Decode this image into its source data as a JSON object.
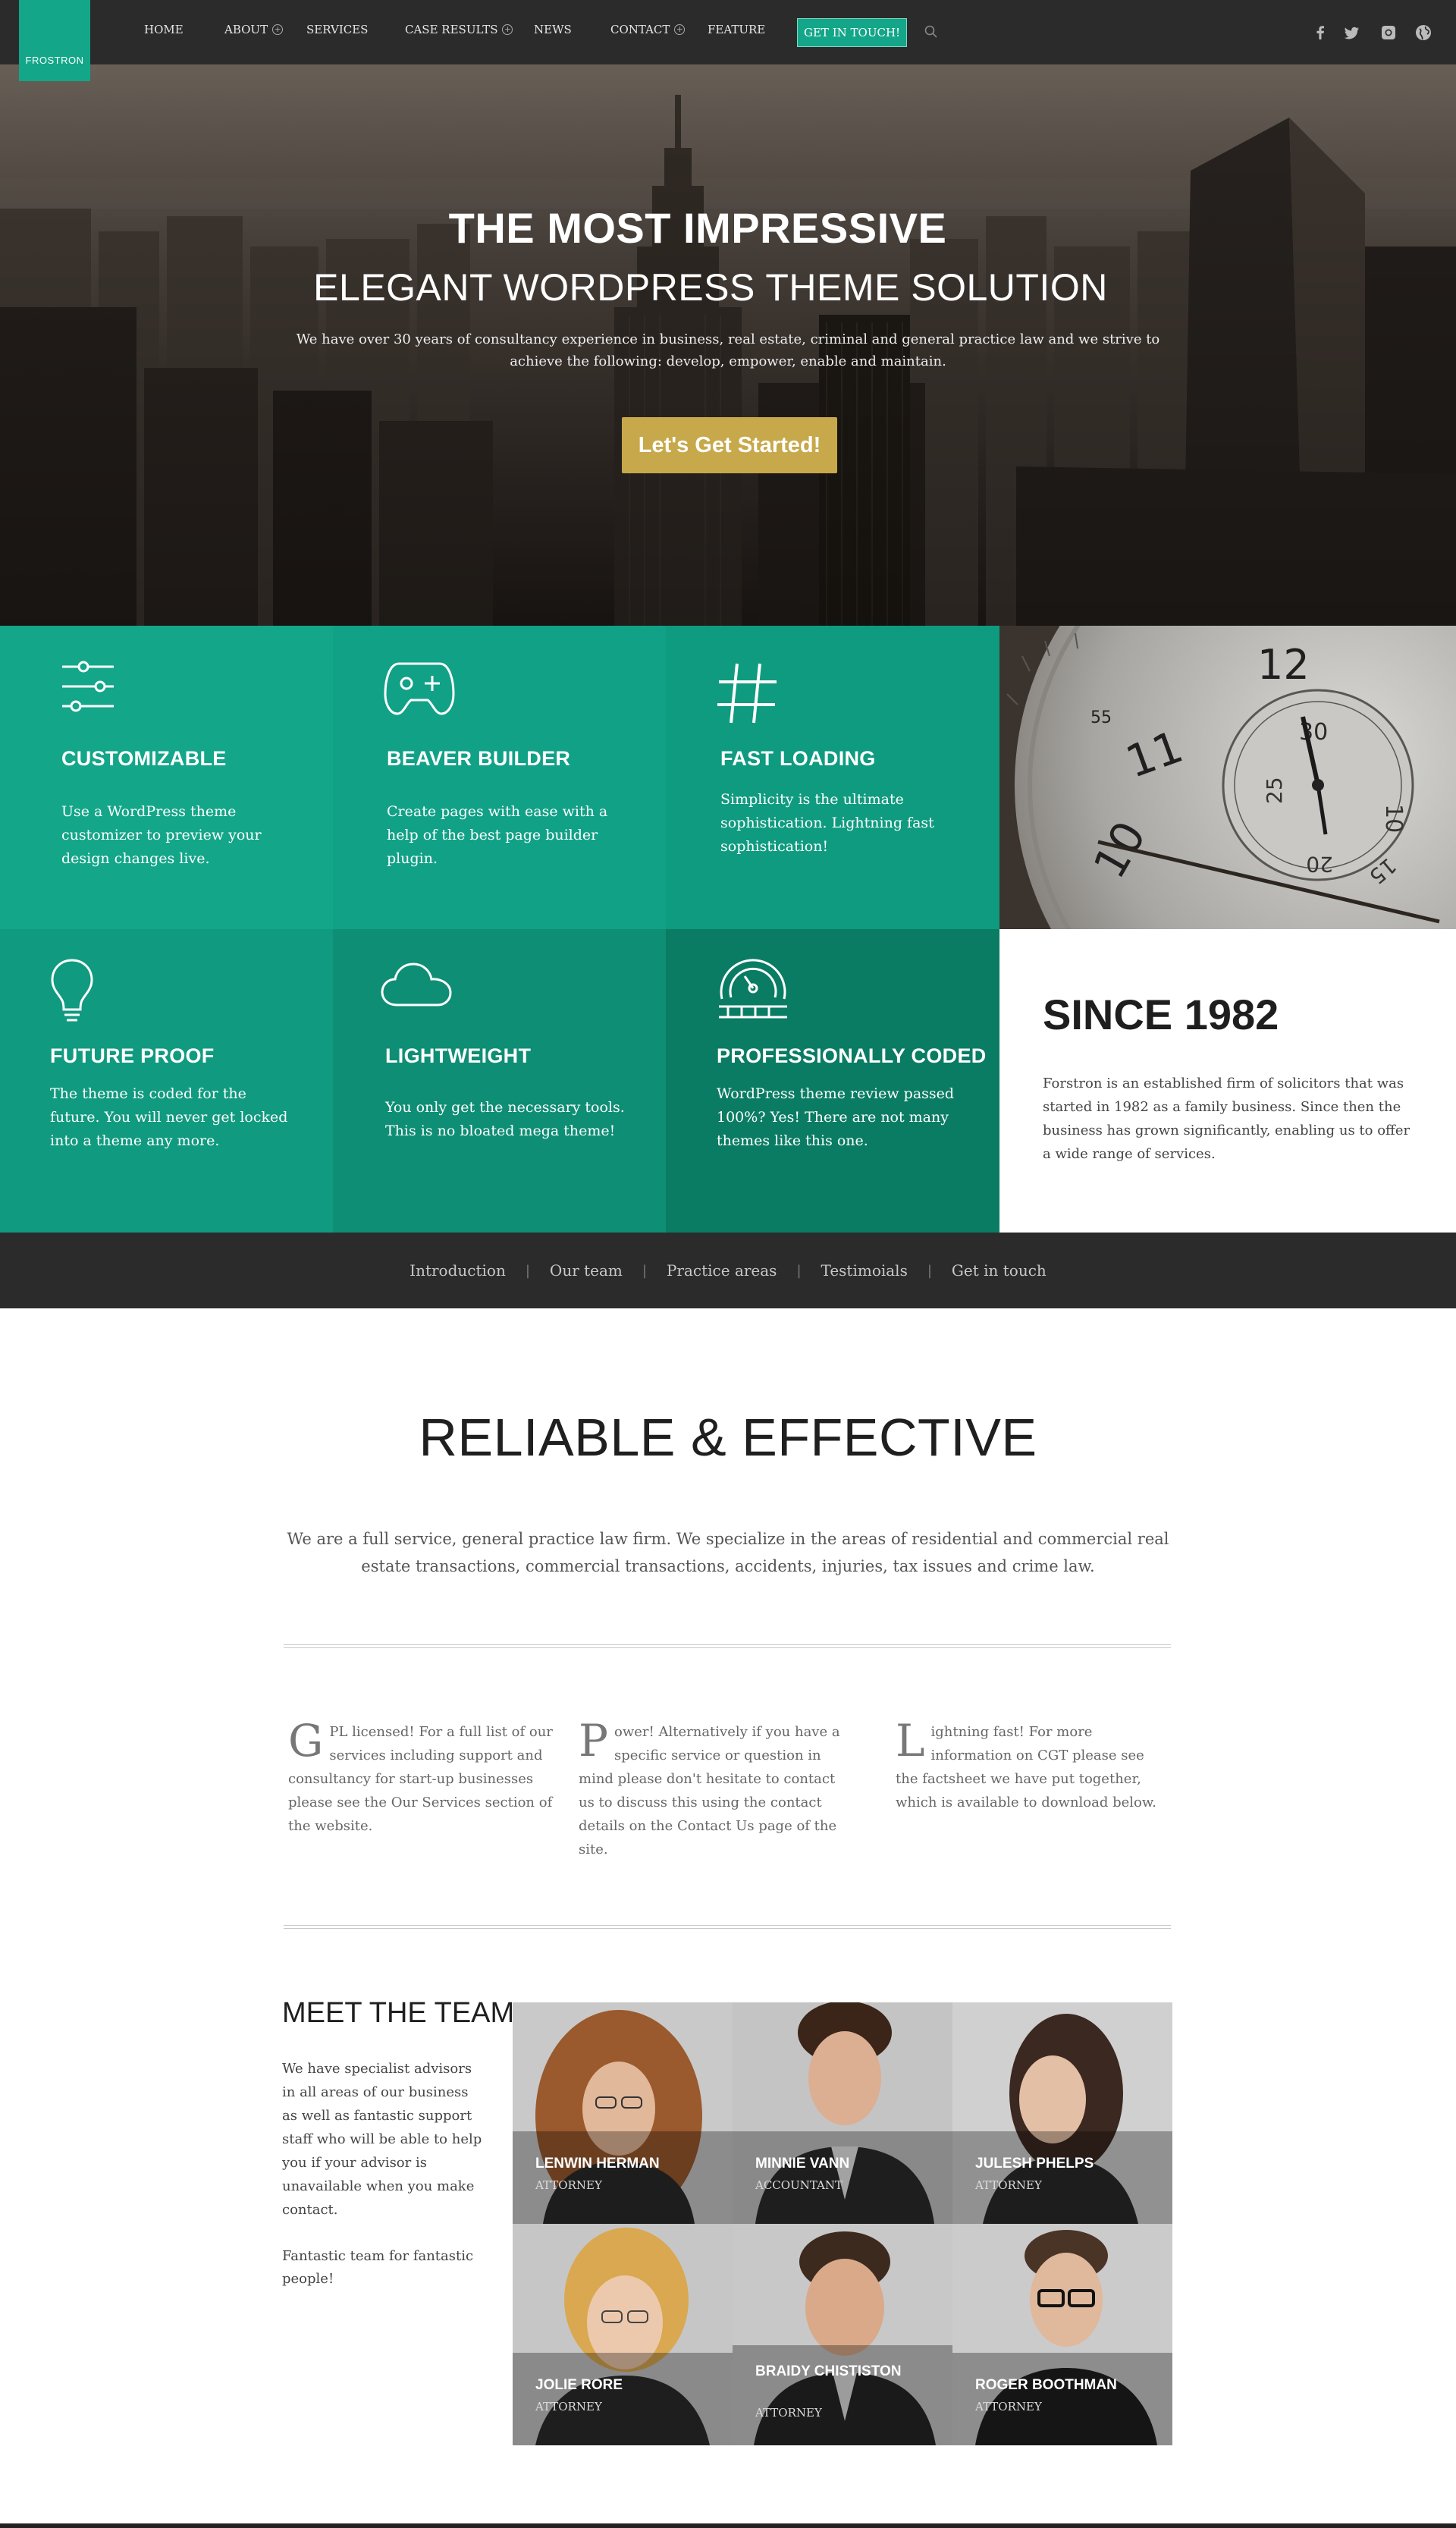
{
  "brand": {
    "logo": "FROSTRON",
    "accent": "#13a689",
    "gold": "#c7a84a",
    "dark": "#2b2b2c"
  },
  "nav": {
    "items": [
      {
        "label": "HOME",
        "has_plus": false
      },
      {
        "label": "ABOUT",
        "has_plus": true
      },
      {
        "label": "SERVICES",
        "has_plus": false
      },
      {
        "label": "CASE RESULTS",
        "has_plus": true
      },
      {
        "label": "NEWS",
        "has_plus": false
      },
      {
        "label": "CONTACT",
        "has_plus": true
      },
      {
        "label": "FEATURE",
        "has_plus": false
      }
    ],
    "cta": "GET IN TOUCH!",
    "social_icons": [
      "facebook-icon",
      "twitter-icon",
      "instagram-icon",
      "globe-icon"
    ]
  },
  "hero": {
    "title": "THE MOST IMPRESSIVE",
    "subtitle": "ELEGANT WORDPRESS THEME SOLUTION",
    "description": "We have over 30 years of consultancy experience in business, real estate, criminal and general practice law and we strive to achieve the following: develop, empower, enable and maintain.",
    "button": "Let's Get Started!"
  },
  "features": [
    {
      "title": "CUSTOMIZABLE",
      "text": "Use a WordPress theme customizer to preview your design changes live.",
      "icon": "sliders-icon"
    },
    {
      "title": "BEAVER BUILDER",
      "text": "Create pages with ease with a help of the best page builder plugin.",
      "icon": "gamepad-icon"
    },
    {
      "title": "FAST LOADING",
      "text": "Simplicity is the ultimate sophistication. Lightning fast sophistication!",
      "icon": "hashtag-icon"
    },
    {
      "title": "FUTURE PROOF",
      "text": "The theme is coded for the future. You will never get locked into a theme any more.",
      "icon": "lightbulb-icon"
    },
    {
      "title": "LIGHTWEIGHT",
      "text": "You only get the necessary tools. This is no bloated mega theme!",
      "icon": "cloud-icon"
    },
    {
      "title": "PROFESSIONALLY CODED",
      "text": "WordPress theme review passed 100%? Yes! There are not many themes like this one.",
      "icon": "speedometer-icon"
    }
  ],
  "since": {
    "title": "SINCE 1982",
    "text": "Forstron is an established firm of solicitors that was started in 1982 as a family business. Since then the business has grown significantly, enabling us to offer a wide range of services."
  },
  "subnav": [
    "Introduction",
    "Our team",
    "Practice areas",
    "Testimoials",
    "Get in touch"
  ],
  "reliable": {
    "title": "RELIABLE & EFFECTIVE",
    "description": "We are a full service, general practice law firm. We specialize in the areas of residential and commercial real estate transactions, commercial transactions, accidents, injuries, tax issues and crime law."
  },
  "columns": [
    {
      "cap": "G",
      "text": "PL licensed! For a full list of our services including support and consultancy for start-up businesses please see the Our Services section of the website."
    },
    {
      "cap": "P",
      "text": "ower! Alternatively if you have a specific service or question in mind please don't hesitate to contact us to discuss this using the contact details on the Contact Us page of the site."
    },
    {
      "cap": "L",
      "text": "ightning fast! For more information on CGT please see the factsheet we have put together, which is available to download below."
    }
  ],
  "team": {
    "title": "MEET THE TEAM",
    "description": "We have specialist advisors in all areas of our business as well as fantastic support staff who will be able to help you if your advisor is unavailable when you make contact.",
    "description2": "Fantastic team for fantastic people!",
    "members": [
      {
        "name": "LENWIN HERMAN",
        "role": "ATTORNEY"
      },
      {
        "name": "MINNIE VANN",
        "role": "ACCOUNTANT"
      },
      {
        "name": "JULESH PHELPS",
        "role": "ATTORNEY"
      },
      {
        "name": "JOLIE RORE",
        "role": "ATTORNEY"
      },
      {
        "name": "BRAIDY CHISTISTON",
        "role": "ATTORNEY"
      },
      {
        "name": "ROGER BOOTHMAN",
        "role": "ATTORNEY"
      }
    ]
  }
}
